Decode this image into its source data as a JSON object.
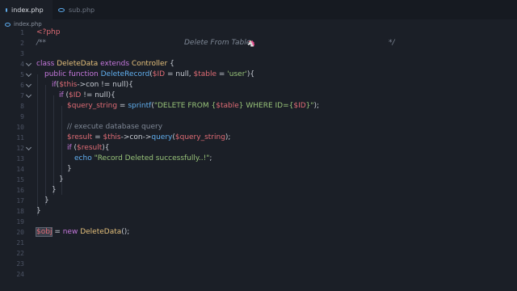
{
  "tabs": [
    {
      "label": "index.php",
      "active": true,
      "modified": true
    },
    {
      "label": "sub.php",
      "active": false,
      "modified": false
    }
  ],
  "breadcrumb": {
    "file": "index.php"
  },
  "line_numbers": [
    "1",
    "2",
    "3",
    "4",
    "5",
    "6",
    "7",
    "8",
    "9",
    "10",
    "11",
    "12",
    "13",
    "14",
    "15",
    "16",
    "17",
    "18",
    "19",
    "20",
    "21",
    "22",
    "23",
    "24"
  ],
  "code": {
    "l1": "<?php",
    "l2_open": "/**",
    "l2_text": "Delete From Table",
    "l2_emoji": "🦄",
    "l2_close": "*/",
    "l4_class": "class",
    "l4_name": "DeleteData",
    "l4_extends": "extends",
    "l4_parent": "Controller",
    "l4_brace": " {",
    "l5_public": "public",
    "l5_function": "function",
    "l5_name": "DeleteRecord",
    "l5_open": "(",
    "l5_id": "$ID",
    "l5_eq1": " = null, ",
    "l5_table": "$table",
    "l5_eq2": " = ",
    "l5_user": "'user'",
    "l5_close": "){",
    "l6_if": "if",
    "l6_open": "(",
    "l6_this": "$this",
    "l6_rest": "->con != null){",
    "l7_if": "if",
    "l7_open": " (",
    "l7_id": "$ID",
    "l7_rest": " != null){",
    "l8_var": "$query_string",
    "l8_eq": " = ",
    "l8_fn": "sprintf",
    "l8_open": "(",
    "l8_str1": "\"DELETE FROM {",
    "l8_table": "$table",
    "l8_str2": "} WHERE ID={",
    "l8_id": "$ID",
    "l8_str3": "}\"",
    "l8_close": ");",
    "l10": "// execute database query",
    "l11_result": "$result",
    "l11_eq": " = ",
    "l11_this": "$this",
    "l11_con": "->con->",
    "l11_fn": "query",
    "l11_open": "(",
    "l11_var": "$query_string",
    "l11_close": ");",
    "l12_if": "if",
    "l12_open": " (",
    "l12_var": "$result",
    "l12_close": "){",
    "l13_echo": "echo",
    "l13_str": " \"Record Deleted successfully..!\"",
    "l13_semi": ";",
    "l14": "}",
    "l15": "}",
    "l16": "}",
    "l17": "}",
    "l18": "}",
    "l20_obj": "$obj",
    "l20_eq": " = ",
    "l20_new": "new",
    "l20_cls": " DeleteData",
    "l20_end": "();"
  },
  "colors": {
    "background": "#1b1f27",
    "keyword": "#c678dd",
    "function": "#61afef",
    "variable": "#e06c75",
    "string": "#98c379",
    "class": "#e5c07b",
    "comment": "#7f8896"
  }
}
